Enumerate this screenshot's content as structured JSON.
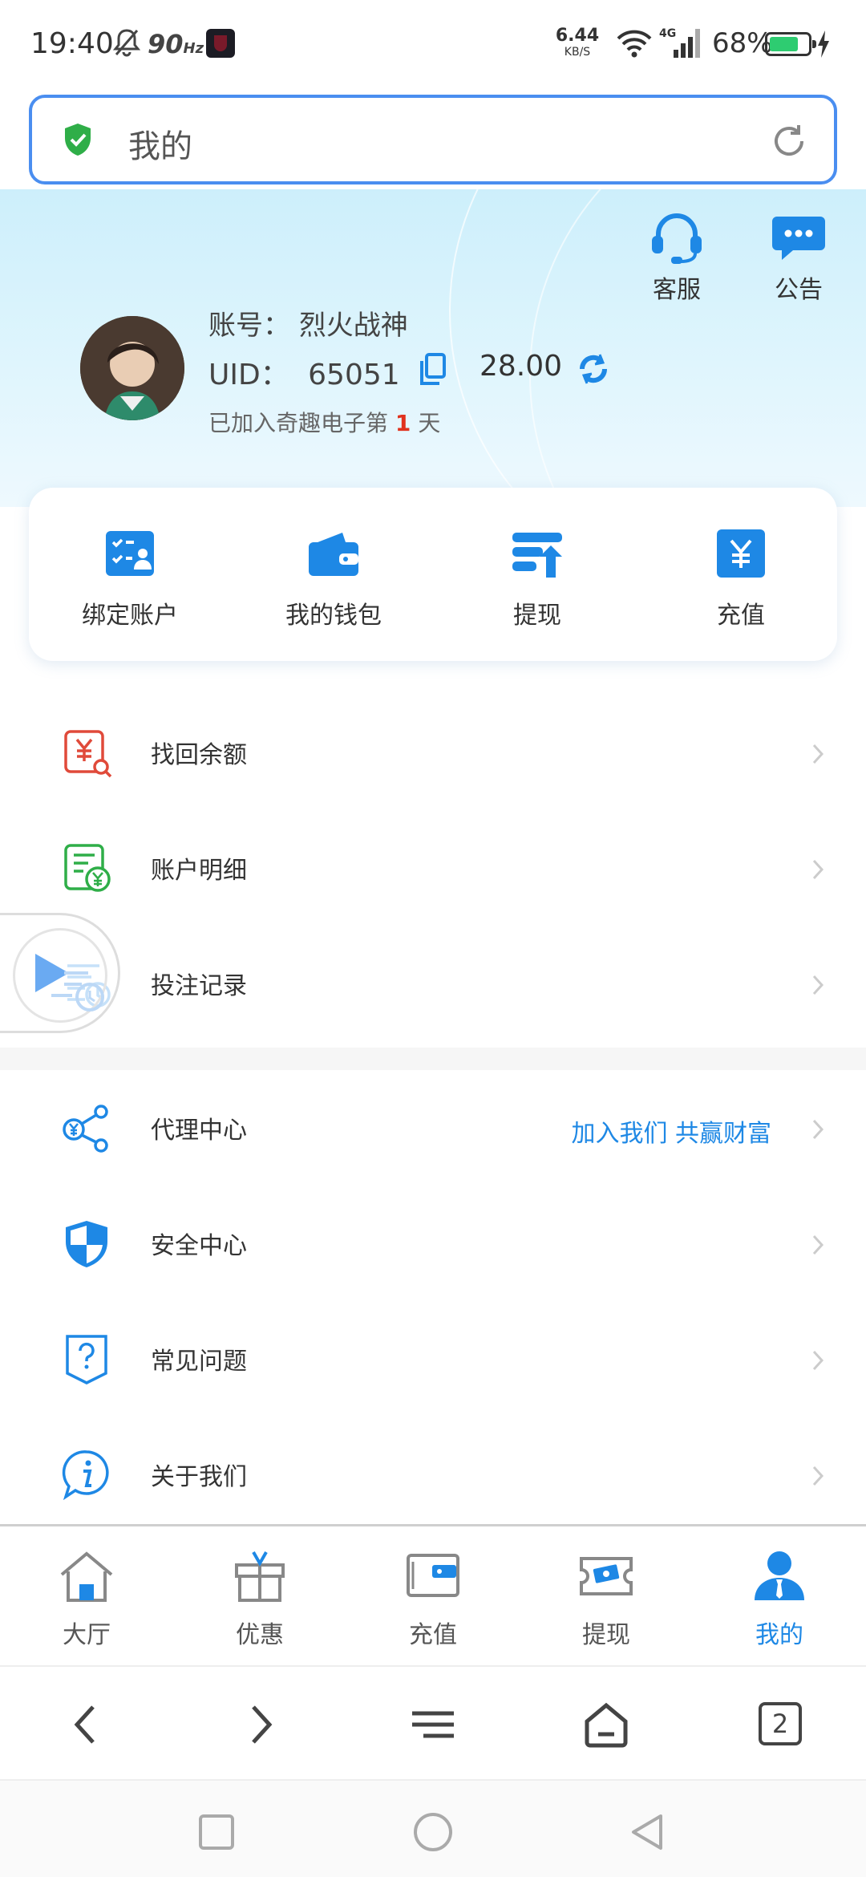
{
  "status_bar": {
    "time": "19:40",
    "refresh_rate": "90",
    "refresh_unit": "Hz",
    "net_speed_value": "6.44",
    "net_speed_unit": "KB/S",
    "network_type": "4G",
    "battery_percent": "68%",
    "battery_level": 0.68
  },
  "address_bar": {
    "title": "我的",
    "secure_icon": "shield-check-icon",
    "reload_icon": "reload-icon"
  },
  "header": {
    "service_label": "客服",
    "notice_label": "公告",
    "account_label": "账号：",
    "account_name": "烈火战神",
    "uid_label": "UID：",
    "uid_value": "65051",
    "balance": "28.00",
    "joined_prefix": "已加入奇趣电子第",
    "joined_days": "1",
    "joined_suffix": "天"
  },
  "quick_actions": [
    {
      "label": "绑定账户",
      "icon": "bind-account-icon"
    },
    {
      "label": "我的钱包",
      "icon": "wallet-icon"
    },
    {
      "label": "提现",
      "icon": "withdraw-icon"
    },
    {
      "label": "充值",
      "icon": "recharge-icon"
    }
  ],
  "menu_group_1": [
    {
      "label": "找回余额",
      "icon": "recover-balance-icon"
    },
    {
      "label": "账户明细",
      "icon": "account-detail-icon"
    },
    {
      "label": "投注记录",
      "icon": "bet-record-icon"
    }
  ],
  "menu_group_2": [
    {
      "label": "代理中心",
      "icon": "agent-center-icon",
      "extra": "加入我们 共赢财富"
    },
    {
      "label": "安全中心",
      "icon": "security-center-icon"
    },
    {
      "label": "常见问题",
      "icon": "faq-icon"
    },
    {
      "label": "关于我们",
      "icon": "about-us-icon"
    }
  ],
  "tab_bar": [
    {
      "label": "大厅",
      "icon": "home-icon",
      "active": false
    },
    {
      "label": "优惠",
      "icon": "gift-icon",
      "active": false
    },
    {
      "label": "充值",
      "icon": "wallet-card-icon",
      "active": false
    },
    {
      "label": "提现",
      "icon": "cash-icon",
      "active": false
    },
    {
      "label": "我的",
      "icon": "user-icon",
      "active": true
    }
  ],
  "browser_nav": {
    "open_tabs": "2"
  },
  "colors": {
    "accent": "#1e88e5",
    "address_border": "#4a8ef0",
    "highlight_red": "#e0321e",
    "header_bg": "#cdeffb"
  }
}
